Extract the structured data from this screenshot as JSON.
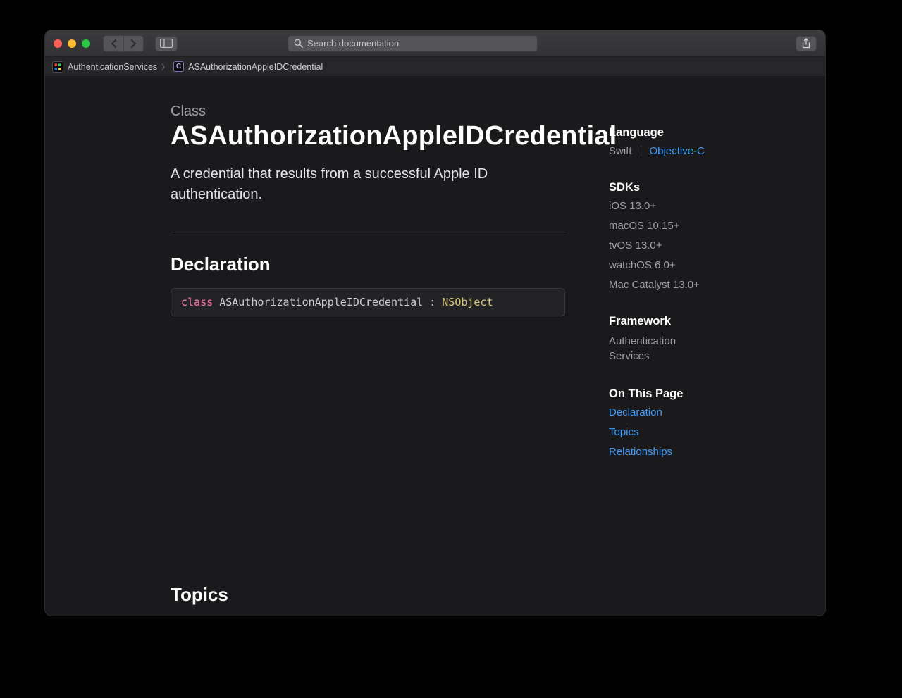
{
  "toolbar": {
    "search_placeholder": "Search documentation"
  },
  "breadcrumb": {
    "root": "AuthenticationServices",
    "leaf": "ASAuthorizationAppleIDCredential"
  },
  "page": {
    "eyebrow": "Class",
    "title": "ASAuthorizationAppleIDCredential",
    "summary": "A credential that results from a successful Apple ID authentication.",
    "section_declaration": "Declaration",
    "section_topics": "Topics",
    "decl": {
      "keyword": "class",
      "name": "ASAuthorizationAppleIDCredential",
      "colon": " : ",
      "super": "NSObject"
    }
  },
  "aside": {
    "language_heading": "Language",
    "language_swift": "Swift",
    "language_objc": "Objective-C",
    "sdks_heading": "SDKs",
    "sdks": [
      "iOS 13.0+",
      "macOS 10.15+",
      "tvOS 13.0+",
      "watchOS 6.0+",
      "Mac Catalyst 13.0+"
    ],
    "framework_heading": "Framework",
    "framework_name": "Authentication Services",
    "otp_heading": "On This Page",
    "otp": [
      "Declaration",
      "Topics",
      "Relationships"
    ]
  }
}
